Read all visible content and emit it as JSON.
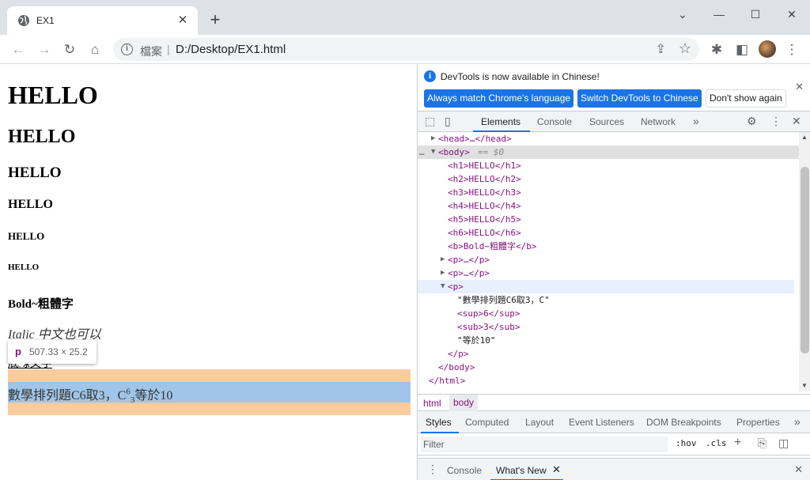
{
  "browser": {
    "tab_title": "EX1",
    "new_tab_symbol": "+",
    "close_symbol": "✕",
    "address_label": "檔案",
    "address_separator": "|",
    "url": "D:/Desktop/EX1.html"
  },
  "page": {
    "h1": "HELLO",
    "h2": "HELLO",
    "h3": "HELLO",
    "h4": "HELLO",
    "h5": "HELLO",
    "h6": "HELLO",
    "bold": "Bold~粗體字",
    "italic": "Italic 中文也可以",
    "underline": "底線文字",
    "math_prefix": "數學排列題C6取3，C",
    "math_sup": "6",
    "math_sub": "3",
    "math_suffix": "等於10"
  },
  "tooltip": {
    "tag": "p",
    "dimensions": "507.33 × 25.2"
  },
  "devtools": {
    "info_message": "DevTools is now available in Chinese!",
    "btn_match_language": "Always match Chrome's language",
    "btn_switch_chinese": "Switch DevTools to Chinese",
    "btn_dont_show": "Don't show again",
    "tabs": [
      "Elements",
      "Console",
      "Sources",
      "Network"
    ],
    "more_tabs": "»",
    "dom": {
      "head": "<head>…</head>",
      "body_open": "<body>",
      "body_hint": "== $0",
      "h1": "<h1>HELLO</h1>",
      "h2": "<h2>HELLO</h2>",
      "h3": "<h3>HELLO</h3>",
      "h4": "<h4>HELLO</h4>",
      "h5": "<h5>HELLO</h5>",
      "h6": "<h6>HELLO</h6>",
      "b": "<b>Bold~粗體字</b>",
      "p1": "<p>…</p>",
      "p2": "<p>…</p>",
      "p3_open": "<p>",
      "text1": "\"數學排列題C6取3，C\"",
      "sup": "<sup>6</sup>",
      "sub": "<sub>3</sub>",
      "text2": "\"等於10\"",
      "p3_close": "</p>",
      "body_close": "</body>",
      "html_close": "</html>"
    },
    "breadcrumbs": [
      "html",
      "body"
    ],
    "style_tabs": [
      "Styles",
      "Computed",
      "Layout",
      "Event Listeners",
      "DOM Breakpoints",
      "Properties"
    ],
    "style_more": "»",
    "filter_placeholder": "Filter",
    "filter_hov": ":hov",
    "filter_cls": ".cls",
    "filter_plus": "+",
    "drawer_tabs": [
      "Console",
      "What's New"
    ],
    "drawer_close_symbol": "✕"
  },
  "colors": {
    "tag": "#881280",
    "accent": "#1a73e8",
    "padding_highlight": "#f9cc9d",
    "content_highlight": "#a0c5e8"
  }
}
